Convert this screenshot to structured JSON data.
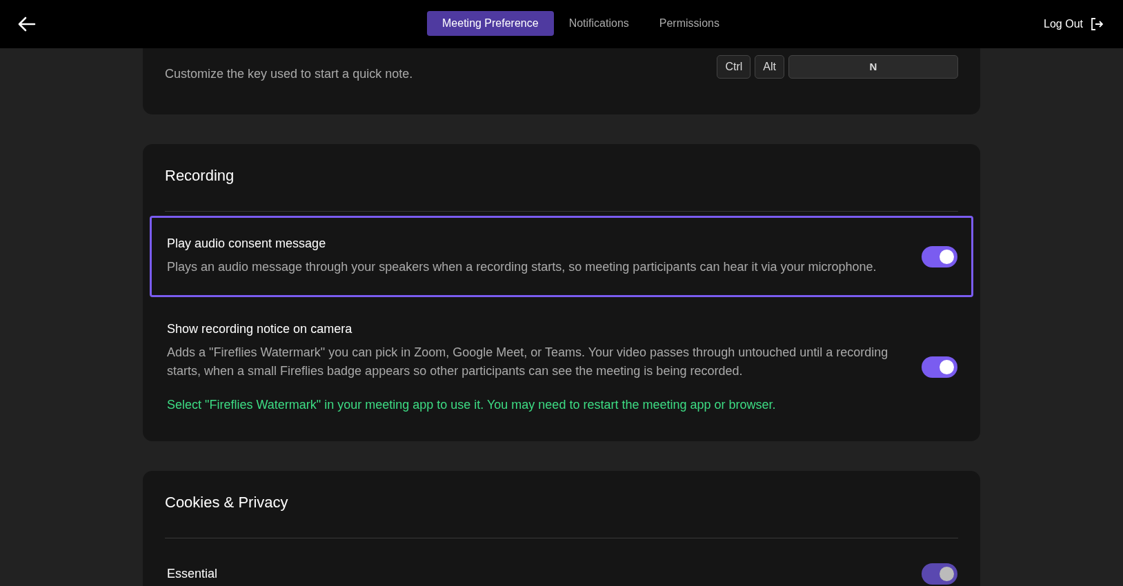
{
  "header": {
    "tabs": [
      {
        "label": "Meeting Preference",
        "selected": true
      },
      {
        "label": "Notifications",
        "selected": false
      },
      {
        "label": "Permissions",
        "selected": false
      }
    ],
    "logout": "Log Out"
  },
  "shortcut": {
    "description": "Customize the key used to start a quick note.",
    "keys": [
      "Ctrl",
      "Alt"
    ],
    "key_field": "N"
  },
  "sections": [
    {
      "title": "Recording",
      "items": [
        {
          "title": "Play audio consent message",
          "description": "Plays an audio message through your speakers when a recording starts, so meeting participants can hear it via your microphone.",
          "on": true,
          "disabled": false,
          "selected": true
        },
        {
          "title": "Show recording notice on camera",
          "description": "Adds a \"Fireflies Watermark\" you can pick in Zoom, Google Meet, or Teams. Your video passes through untouched until a recording starts, when a small Fireflies badge appears so other participants can see the meeting is being recorded.",
          "note": "Select \"Fireflies Watermark\" in your meeting app to use it. You may need to restart the meeting app or browser.",
          "on": true,
          "disabled": false,
          "selected": false
        }
      ]
    },
    {
      "title": "Cookies & Privacy",
      "items": [
        {
          "title": "Essential",
          "on": true,
          "disabled": true,
          "selected": false
        }
      ]
    }
  ]
}
